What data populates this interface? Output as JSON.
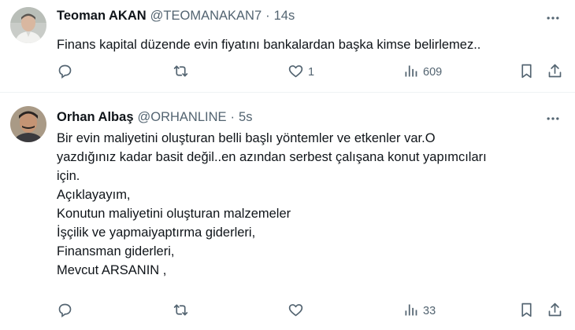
{
  "tweets": [
    {
      "display_name": "Teoman AKAN",
      "handle": "@TEOMANAKAN7",
      "separator": "·",
      "time": "14s",
      "text_lines": [
        "Finans kapital düzende evin fiyatını bankalardan başka kimse belirlemez.."
      ],
      "likes": "1",
      "views": "609"
    },
    {
      "display_name": "Orhan Albaş",
      "handle": "@ORHANLINE",
      "separator": "·",
      "time": "5s",
      "text_lines": [
        "Bir evin maliyetini oluşturan belli başlı yöntemler ve etkenler var.O",
        "yazdığınız kadar basit değil..en azından serbest çalışana konut yapımcıları",
        "için.",
        "Açıklayayım,",
        "Konutun maliyetini oluşturan malzemeler",
        "İşçilik ve yapmaiyaptırma giderleri,",
        "Finansman giderleri,",
        "Mevcut ARSANIN ,"
      ],
      "likes": "",
      "views": "33"
    }
  ],
  "colors": {
    "text": "#0f1419",
    "secondary": "#536471",
    "divider": "#eff3f4",
    "background": "#ffffff"
  },
  "icons": [
    "more-icon",
    "reply-icon",
    "retweet-icon",
    "like-icon",
    "views-icon",
    "bookmark-icon",
    "share-icon"
  ]
}
